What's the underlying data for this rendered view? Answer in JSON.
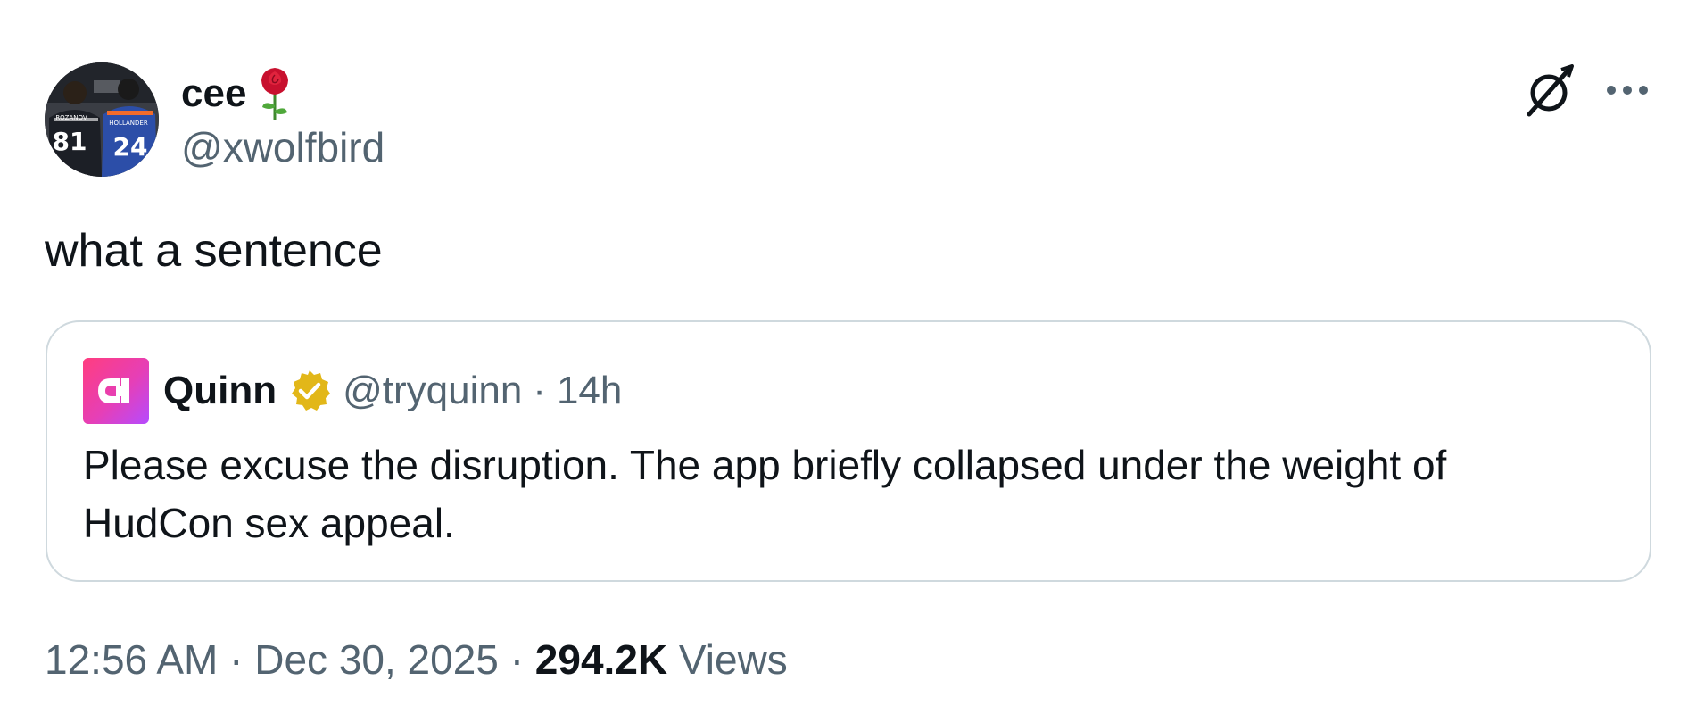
{
  "author": {
    "display_name": "cee",
    "handle": "@xwolfbird",
    "emoji_icon": "rose-icon",
    "avatar_jersey_left": "81",
    "avatar_jersey_right": "24",
    "avatar_name_left": "ROZANOV",
    "avatar_name_right": "HOLLANDER"
  },
  "tweet": {
    "text": "what a sentence"
  },
  "quoted": {
    "display_name": "Quinn",
    "handle": "@tryquinn",
    "separator": "·",
    "time": "14h",
    "text": "Please excuse the disruption. The app briefly collapsed under the weight of HudCon sex appeal.",
    "verified_color": "#e2b719",
    "logo_icon": "quinn-logo-icon"
  },
  "meta": {
    "time": "12:56 AM",
    "separator": "·",
    "date": "Dec 30, 2025",
    "views_count": "294.2K",
    "views_label": "Views"
  },
  "colors": {
    "text_primary": "#0f1419",
    "text_secondary": "#536471",
    "border": "#cfd9de"
  }
}
